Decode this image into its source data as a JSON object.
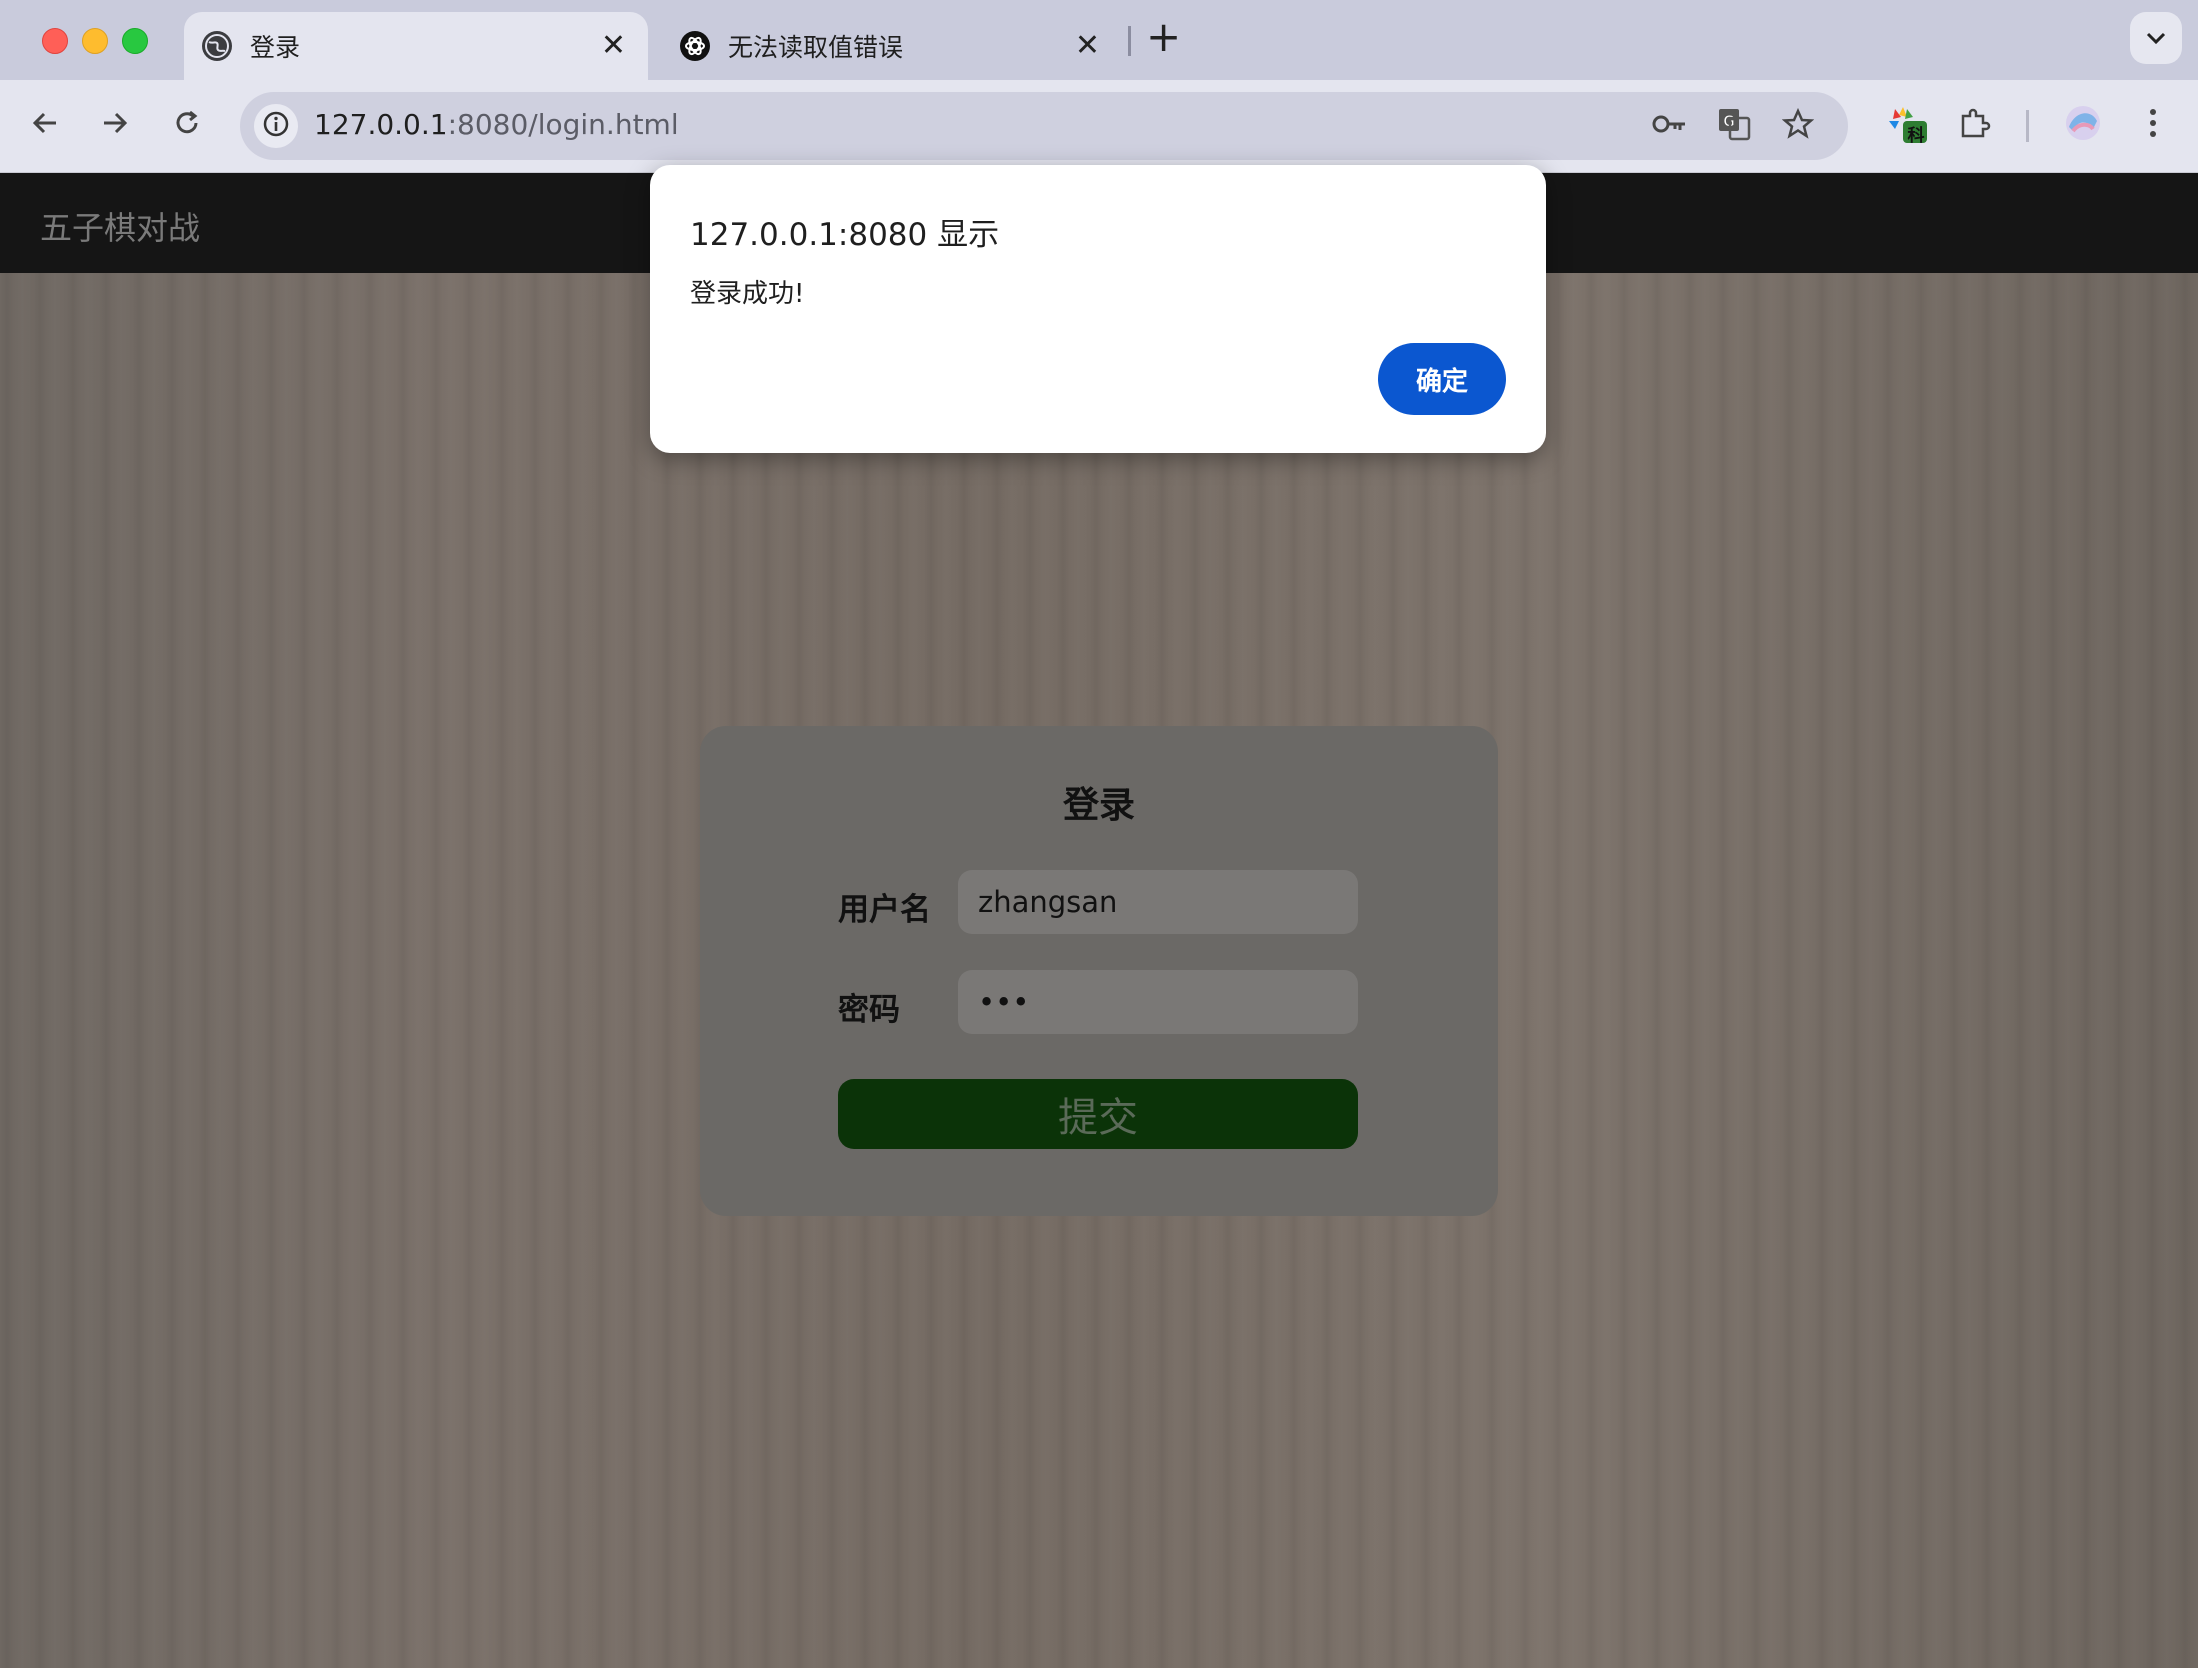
{
  "browser": {
    "tabs": [
      {
        "title": "登录",
        "active": true,
        "icon": "globe-icon"
      },
      {
        "title": "无法读取值错误",
        "active": false,
        "icon": "openai-icon"
      }
    ],
    "new_tab_label": "+",
    "tab_close_glyph": "✕",
    "url_host": "127.0.0.1",
    "url_rest": ":8080/login.html"
  },
  "navbar": {
    "title": "五子棋对战"
  },
  "login": {
    "title": "登录",
    "username_label": "用户名",
    "username_value": "zhangsan",
    "password_label": "密码",
    "password_value": "•••",
    "submit_label": "提交"
  },
  "dialog": {
    "title": "127.0.0.1:8080 显示",
    "message": "登录成功!",
    "ok_label": "确定"
  },
  "extensions": {
    "badge_text": "科"
  },
  "colors": {
    "dialog_button": "#0b57d0",
    "submit_button": "#0b3308",
    "navbar": "#151515"
  }
}
